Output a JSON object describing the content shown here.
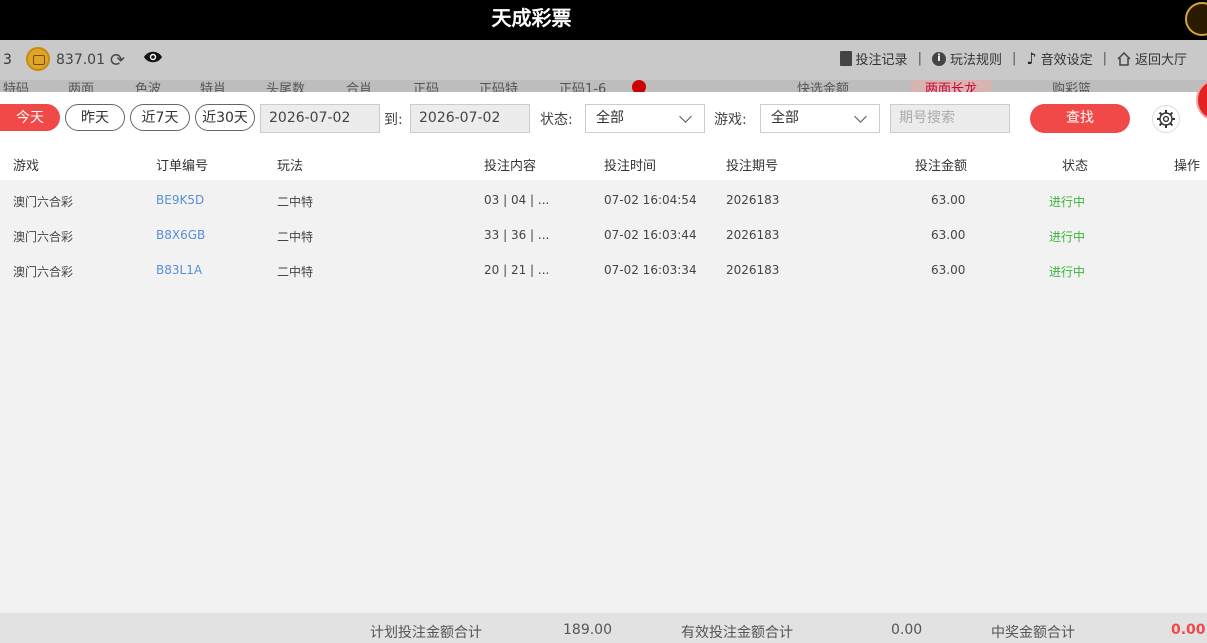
{
  "header": {
    "title": "天成彩票"
  },
  "account": {
    "partial": "3",
    "balance": "837.01"
  },
  "toplinks": [
    {
      "label": "投注记录",
      "icon": "document-icon"
    },
    {
      "label": "玩法规则",
      "icon": "info-icon"
    },
    {
      "label": "音效设定",
      "icon": "music-note-icon"
    },
    {
      "label": "返回大厅",
      "icon": "home-icon"
    }
  ],
  "navstrip": [
    "特码",
    "两面",
    "色波",
    "特肖",
    "头尾数",
    "合肖",
    "正码",
    "正码特",
    "正码1-6",
    "快选金额",
    "两面长龙",
    "购彩篮"
  ],
  "filter": {
    "quick": [
      "今天",
      "昨天",
      "近7天",
      "近30天"
    ],
    "date_from": "2026-07-02",
    "to_label": "到:",
    "date_to": "2026-07-02",
    "status_label": "状态:",
    "status_value": "全部",
    "game_label": "游戏:",
    "game_value": "全部",
    "search_placeholder": "期号搜索",
    "find_label": "查找"
  },
  "table": {
    "headers": [
      "游戏",
      "订单编号",
      "玩法",
      "投注内容",
      "投注时间",
      "投注期号",
      "投注金额",
      "状态",
      "操作"
    ],
    "rows": [
      [
        "澳门六合彩",
        "BE9K5D",
        "二中特",
        "03 | 04 | ...",
        "07-02 16:04:54",
        "2026183",
        "63.00",
        "进行中"
      ],
      [
        "澳门六合彩",
        "B8X6GB",
        "二中特",
        "33 | 36 | ...",
        "07-02 16:03:44",
        "2026183",
        "63.00",
        "进行中"
      ],
      [
        "澳门六合彩",
        "B83L1A",
        "二中特",
        "20 | 21 | ...",
        "07-02 16:03:34",
        "2026183",
        "63.00",
        "进行中"
      ]
    ]
  },
  "footer": {
    "planned_label": "计划投注金额合计",
    "planned_value": "189.00",
    "valid_label": "有效投注金额合计",
    "valid_value": "0.00",
    "win_label": "中奖金额合计",
    "win_value": "0.00"
  }
}
